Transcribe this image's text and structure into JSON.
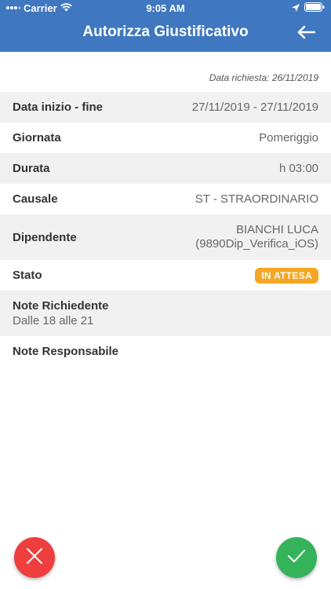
{
  "statusbar": {
    "carrier": "Carrier",
    "time": "9:05 AM"
  },
  "header": {
    "title": "Autorizza Giustificativo"
  },
  "date_requested": "Data richiesta: 26/11/2019",
  "fields": {
    "period": {
      "label": "Data inizio - fine",
      "value": "27/11/2019 - 27/11/2019"
    },
    "day": {
      "label": "Giornata",
      "value": "Pomeriggio"
    },
    "duration": {
      "label": "Durata",
      "value": "h 03:00"
    },
    "reason": {
      "label": "Causale",
      "value": "ST - STRAORDINARIO"
    },
    "employee": {
      "label": "Dipendente",
      "name": "BIANCHI LUCA",
      "id": "(9890Dip_Verifica_iOS)"
    },
    "status": {
      "label": "Stato",
      "value": "IN ATTESA"
    },
    "requester_notes": {
      "label": "Note Richiedente",
      "value": "Dalle 18 alle 21"
    },
    "manager_notes": {
      "label": "Note Responsabile",
      "value": ""
    }
  },
  "colors": {
    "header": "#3f78c0",
    "badge": "#f5a623",
    "reject": "#ee3e3e",
    "approve": "#34b35a"
  }
}
